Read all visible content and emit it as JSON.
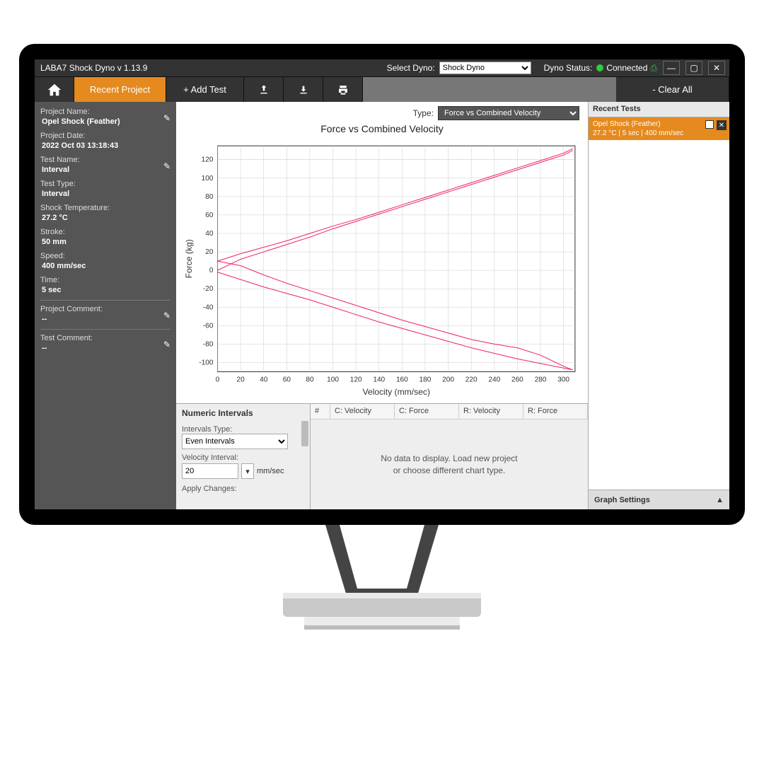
{
  "titlebar": {
    "app_title": "LABA7 Shock Dyno v 1.13.9",
    "select_dyno_label": "Select Dyno:",
    "select_dyno_value": "Shock Dyno",
    "status_label": "Dyno Status:",
    "status_value": "Connected"
  },
  "toolbar": {
    "recent_project": "Recent Project",
    "add_test": "+ Add Test",
    "clear_all": "- Clear All"
  },
  "sidebar": {
    "project_name_label": "Project Name:",
    "project_name": "Opel Shock (Feather)",
    "project_date_label": "Project Date:",
    "project_date": "2022 Oct 03 13:18:43",
    "test_name_label": "Test Name:",
    "test_name": "Interval",
    "test_type_label": "Test Type:",
    "test_type": "Interval",
    "shock_temp_label": "Shock Temperature:",
    "shock_temp": "27.2 °C",
    "stroke_label": "Stroke:",
    "stroke": "50 mm",
    "speed_label": "Speed:",
    "speed": "400 mm/sec",
    "time_label": "Time:",
    "time": "5 sec",
    "project_comment_label": "Project Comment:",
    "project_comment": "--",
    "test_comment_label": "Test Comment:",
    "test_comment": "--"
  },
  "chart": {
    "type_label": "Type:",
    "type_value": "Force vs Combined Velocity",
    "title": "Force vs Combined Velocity"
  },
  "intervals": {
    "panel_title": "Numeric Intervals",
    "type_label": "Intervals Type:",
    "type_value": "Even Intervals",
    "velocity_label": "Velocity Interval:",
    "velocity_value": "20",
    "velocity_unit": "mm/sec",
    "apply_label": "Apply Changes:"
  },
  "table": {
    "col_num": "#",
    "col_cv": "C: Velocity",
    "col_cf": "C: Force",
    "col_rv": "R: Velocity",
    "col_rf": "R: Force",
    "empty1": "No data to display. Load new project",
    "empty2": "or choose different chart type."
  },
  "recent": {
    "title": "Recent Tests",
    "item_name": "Opel Shock (Feather)",
    "item_meta": "27.2 °C | 5 sec | 400 mm/sec",
    "graph_settings": "Graph Settings"
  },
  "chart_data": {
    "type": "line",
    "title": "Force vs Combined Velocity",
    "xlabel": "Velocity (mm/sec)",
    "ylabel": "Force (kg)",
    "xlim": [
      0,
      310
    ],
    "ylim": [
      -110,
      135
    ],
    "x_ticks": [
      0,
      20,
      40,
      60,
      80,
      100,
      120,
      140,
      160,
      180,
      200,
      220,
      240,
      260,
      280,
      300
    ],
    "y_ticks": [
      -100,
      -80,
      -60,
      -40,
      -20,
      0,
      20,
      40,
      60,
      80,
      100,
      120
    ],
    "series": [
      {
        "name": "upper_out",
        "color": "#e26",
        "x": [
          0,
          20,
          40,
          60,
          80,
          100,
          120,
          140,
          160,
          180,
          200,
          220,
          240,
          260,
          280,
          300,
          308
        ],
        "y": [
          10,
          18,
          25,
          32,
          40,
          48,
          55,
          63,
          71,
          79,
          87,
          95,
          103,
          111,
          119,
          127,
          132
        ]
      },
      {
        "name": "upper_in",
        "color": "#e26",
        "x": [
          0,
          20,
          40,
          60,
          80,
          100,
          120,
          140,
          160,
          180,
          200,
          220,
          240,
          260,
          280,
          300,
          308
        ],
        "y": [
          0,
          12,
          20,
          28,
          36,
          45,
          53,
          61,
          69,
          77,
          85,
          93,
          101,
          109,
          117,
          125,
          130
        ]
      },
      {
        "name": "lower_out",
        "color": "#e26",
        "x": [
          0,
          20,
          40,
          60,
          80,
          100,
          120,
          140,
          160,
          180,
          200,
          220,
          240,
          260,
          280,
          300,
          308
        ],
        "y": [
          10,
          5,
          -5,
          -14,
          -22,
          -30,
          -38,
          -46,
          -54,
          -61,
          -68,
          -75,
          -80,
          -84,
          -92,
          -104,
          -108
        ]
      },
      {
        "name": "lower_in",
        "color": "#e26",
        "x": [
          0,
          20,
          40,
          60,
          80,
          100,
          120,
          140,
          160,
          180,
          200,
          220,
          240,
          260,
          280,
          300,
          308
        ],
        "y": [
          -2,
          -10,
          -18,
          -25,
          -32,
          -40,
          -48,
          -56,
          -63,
          -70,
          -77,
          -84,
          -90,
          -96,
          -101,
          -106,
          -108
        ]
      }
    ]
  }
}
